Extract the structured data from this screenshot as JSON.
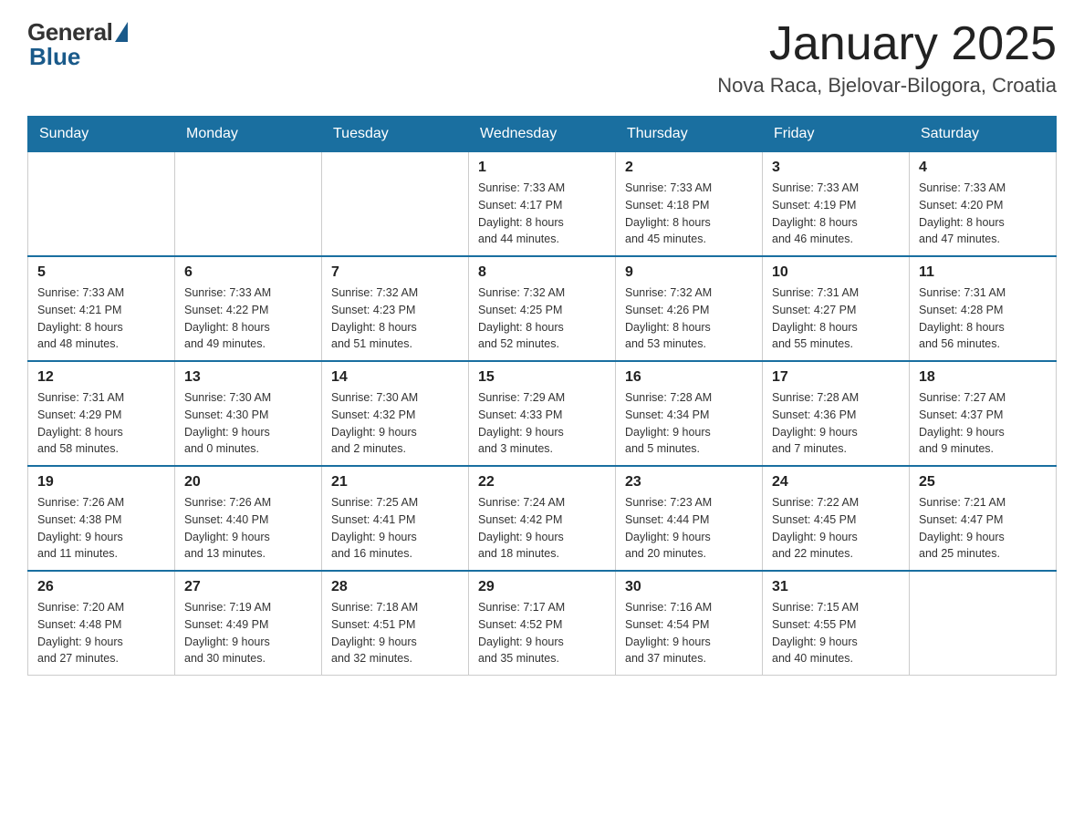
{
  "header": {
    "logo": {
      "general": "General",
      "blue": "Blue"
    },
    "title": "January 2025",
    "location": "Nova Raca, Bjelovar-Bilogora, Croatia"
  },
  "calendar": {
    "days_of_week": [
      "Sunday",
      "Monday",
      "Tuesday",
      "Wednesday",
      "Thursday",
      "Friday",
      "Saturday"
    ],
    "weeks": [
      [
        {
          "day": "",
          "info": ""
        },
        {
          "day": "",
          "info": ""
        },
        {
          "day": "",
          "info": ""
        },
        {
          "day": "1",
          "info": "Sunrise: 7:33 AM\nSunset: 4:17 PM\nDaylight: 8 hours\nand 44 minutes."
        },
        {
          "day": "2",
          "info": "Sunrise: 7:33 AM\nSunset: 4:18 PM\nDaylight: 8 hours\nand 45 minutes."
        },
        {
          "day": "3",
          "info": "Sunrise: 7:33 AM\nSunset: 4:19 PM\nDaylight: 8 hours\nand 46 minutes."
        },
        {
          "day": "4",
          "info": "Sunrise: 7:33 AM\nSunset: 4:20 PM\nDaylight: 8 hours\nand 47 minutes."
        }
      ],
      [
        {
          "day": "5",
          "info": "Sunrise: 7:33 AM\nSunset: 4:21 PM\nDaylight: 8 hours\nand 48 minutes."
        },
        {
          "day": "6",
          "info": "Sunrise: 7:33 AM\nSunset: 4:22 PM\nDaylight: 8 hours\nand 49 minutes."
        },
        {
          "day": "7",
          "info": "Sunrise: 7:32 AM\nSunset: 4:23 PM\nDaylight: 8 hours\nand 51 minutes."
        },
        {
          "day": "8",
          "info": "Sunrise: 7:32 AM\nSunset: 4:25 PM\nDaylight: 8 hours\nand 52 minutes."
        },
        {
          "day": "9",
          "info": "Sunrise: 7:32 AM\nSunset: 4:26 PM\nDaylight: 8 hours\nand 53 minutes."
        },
        {
          "day": "10",
          "info": "Sunrise: 7:31 AM\nSunset: 4:27 PM\nDaylight: 8 hours\nand 55 minutes."
        },
        {
          "day": "11",
          "info": "Sunrise: 7:31 AM\nSunset: 4:28 PM\nDaylight: 8 hours\nand 56 minutes."
        }
      ],
      [
        {
          "day": "12",
          "info": "Sunrise: 7:31 AM\nSunset: 4:29 PM\nDaylight: 8 hours\nand 58 minutes."
        },
        {
          "day": "13",
          "info": "Sunrise: 7:30 AM\nSunset: 4:30 PM\nDaylight: 9 hours\nand 0 minutes."
        },
        {
          "day": "14",
          "info": "Sunrise: 7:30 AM\nSunset: 4:32 PM\nDaylight: 9 hours\nand 2 minutes."
        },
        {
          "day": "15",
          "info": "Sunrise: 7:29 AM\nSunset: 4:33 PM\nDaylight: 9 hours\nand 3 minutes."
        },
        {
          "day": "16",
          "info": "Sunrise: 7:28 AM\nSunset: 4:34 PM\nDaylight: 9 hours\nand 5 minutes."
        },
        {
          "day": "17",
          "info": "Sunrise: 7:28 AM\nSunset: 4:36 PM\nDaylight: 9 hours\nand 7 minutes."
        },
        {
          "day": "18",
          "info": "Sunrise: 7:27 AM\nSunset: 4:37 PM\nDaylight: 9 hours\nand 9 minutes."
        }
      ],
      [
        {
          "day": "19",
          "info": "Sunrise: 7:26 AM\nSunset: 4:38 PM\nDaylight: 9 hours\nand 11 minutes."
        },
        {
          "day": "20",
          "info": "Sunrise: 7:26 AM\nSunset: 4:40 PM\nDaylight: 9 hours\nand 13 minutes."
        },
        {
          "day": "21",
          "info": "Sunrise: 7:25 AM\nSunset: 4:41 PM\nDaylight: 9 hours\nand 16 minutes."
        },
        {
          "day": "22",
          "info": "Sunrise: 7:24 AM\nSunset: 4:42 PM\nDaylight: 9 hours\nand 18 minutes."
        },
        {
          "day": "23",
          "info": "Sunrise: 7:23 AM\nSunset: 4:44 PM\nDaylight: 9 hours\nand 20 minutes."
        },
        {
          "day": "24",
          "info": "Sunrise: 7:22 AM\nSunset: 4:45 PM\nDaylight: 9 hours\nand 22 minutes."
        },
        {
          "day": "25",
          "info": "Sunrise: 7:21 AM\nSunset: 4:47 PM\nDaylight: 9 hours\nand 25 minutes."
        }
      ],
      [
        {
          "day": "26",
          "info": "Sunrise: 7:20 AM\nSunset: 4:48 PM\nDaylight: 9 hours\nand 27 minutes."
        },
        {
          "day": "27",
          "info": "Sunrise: 7:19 AM\nSunset: 4:49 PM\nDaylight: 9 hours\nand 30 minutes."
        },
        {
          "day": "28",
          "info": "Sunrise: 7:18 AM\nSunset: 4:51 PM\nDaylight: 9 hours\nand 32 minutes."
        },
        {
          "day": "29",
          "info": "Sunrise: 7:17 AM\nSunset: 4:52 PM\nDaylight: 9 hours\nand 35 minutes."
        },
        {
          "day": "30",
          "info": "Sunrise: 7:16 AM\nSunset: 4:54 PM\nDaylight: 9 hours\nand 37 minutes."
        },
        {
          "day": "31",
          "info": "Sunrise: 7:15 AM\nSunset: 4:55 PM\nDaylight: 9 hours\nand 40 minutes."
        },
        {
          "day": "",
          "info": ""
        }
      ]
    ]
  }
}
